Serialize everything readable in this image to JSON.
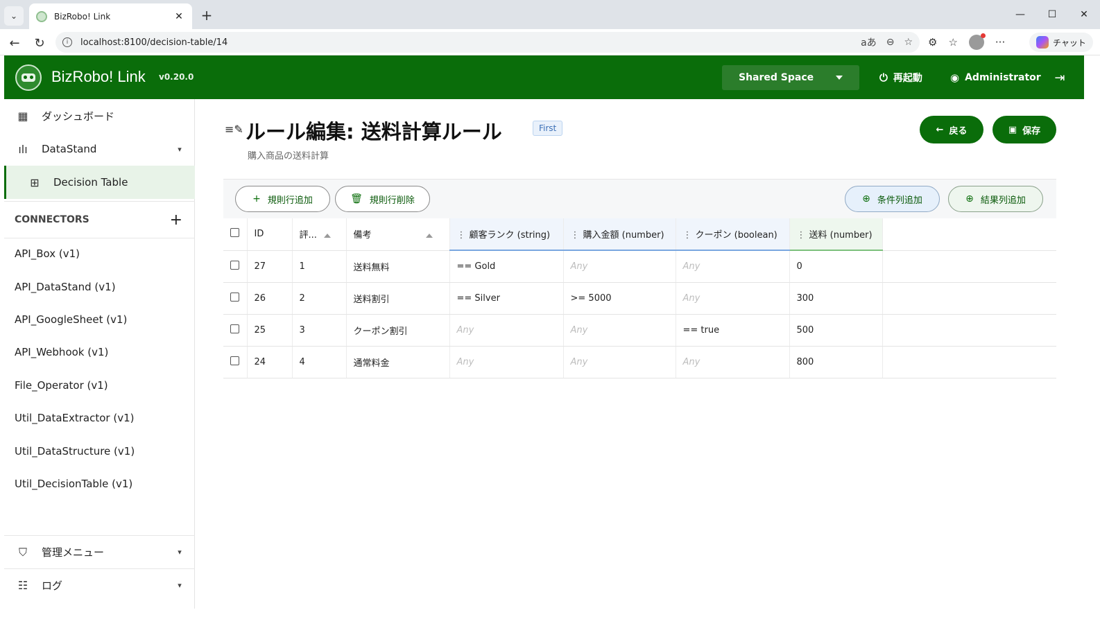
{
  "browser": {
    "tab_title": "BizRobo! Link",
    "url": "localhost:8100/decision-table/14",
    "copilot_label": "チャット"
  },
  "header": {
    "app_name": "BizRobo! Link",
    "version": "v0.20.0",
    "space": "Shared Space",
    "restart_label": "再起動",
    "user_label": "Administrator"
  },
  "sidebar": {
    "dashboard": "ダッシュボード",
    "datastand": "DataStand",
    "decision_table": "Decision Table",
    "connectors_title": "CONNECTORS",
    "connectors": [
      "API_Box (v1)",
      "API_DataStand (v1)",
      "API_GoogleSheet (v1)",
      "API_Webhook (v1)",
      "File_Operator (v1)",
      "Util_DataExtractor (v1)",
      "Util_DataStructure (v1)",
      "Util_DecisionTable (v1)"
    ],
    "admin_menu": "管理メニュー",
    "log": "ログ"
  },
  "main": {
    "title": "ルール編集: 送料計算ルール",
    "badge": "First",
    "subtitle": "購入商品の送料計算",
    "back_label": "戻る",
    "save_label": "保存",
    "toolbar": {
      "add_row": "規則行追加",
      "delete_row": "規則行削除",
      "add_condition": "条件列追加",
      "add_result": "結果列追加"
    },
    "columns": {
      "id": "ID",
      "priority": "評...",
      "note": "備考",
      "cond1": "顧客ランク (string)",
      "cond2": "購入金額 (number)",
      "cond3": "クーポン (boolean)",
      "result1": "送料 (number)"
    },
    "rows": [
      {
        "id": "27",
        "priority": "1",
        "note": "送料無料",
        "c1": "== Gold",
        "c2": "Any",
        "c3": "Any",
        "r1": "0"
      },
      {
        "id": "26",
        "priority": "2",
        "note": "送料割引",
        "c1": "== Silver",
        "c2": ">= 5000",
        "c3": "Any",
        "r1": "300"
      },
      {
        "id": "25",
        "priority": "3",
        "note": "クーポン割引",
        "c1": "Any",
        "c2": "Any",
        "c3": "== true",
        "r1": "500"
      },
      {
        "id": "24",
        "priority": "4",
        "note": "通常料金",
        "c1": "Any",
        "c2": "Any",
        "c3": "Any",
        "r1": "800"
      }
    ]
  }
}
